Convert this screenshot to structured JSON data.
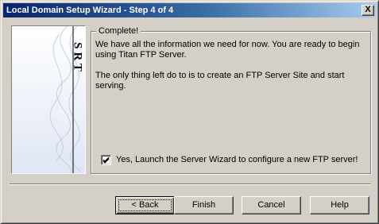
{
  "window": {
    "title": "Local Domain Setup Wizard - Step 4 of 4",
    "close_label": "X"
  },
  "banner": {
    "logo_text": "SRT"
  },
  "content": {
    "group_title": "Complete!",
    "paragraph1": "We have all the information we need for now. You are ready to begin using Titan FTP Server.",
    "paragraph2": "The only thing left do to is to create an FTP Server Site and start serving.",
    "launch_checkbox": {
      "label": "Yes, Launch the Server Wizard to configure a new FTP server!",
      "checked": true
    }
  },
  "buttons": {
    "back": "< Back",
    "finish": "Finish",
    "cancel": "Cancel",
    "help": "Help"
  },
  "colors": {
    "title_bar_start": "#0a246a",
    "title_bar_end": "#a6caf0",
    "face": "#d4d0c8"
  }
}
